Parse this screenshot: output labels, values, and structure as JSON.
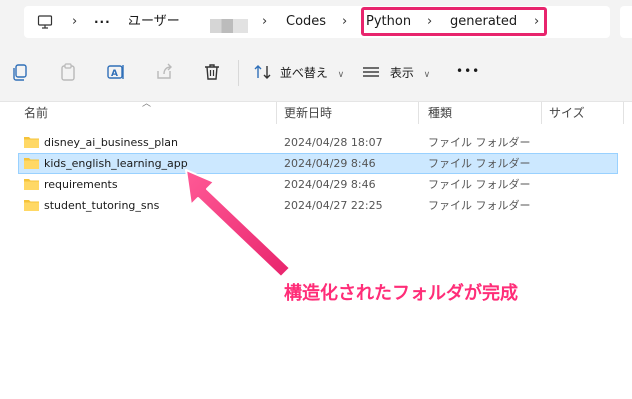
{
  "breadcrumb": {
    "items": [
      "ユーザー",
      "Codes",
      "Python",
      "generated"
    ],
    "overflow": "···"
  },
  "toolbar": {
    "sort_label": "並べ替え",
    "view_label": "表示",
    "more_label": "•••"
  },
  "columns": {
    "name": "名前",
    "modified": "更新日時",
    "type": "種類",
    "size": "サイズ"
  },
  "files": [
    {
      "name": "disney_ai_business_plan",
      "modified": "2024/04/28 18:07",
      "type": "ファイル フォルダー",
      "selected": false
    },
    {
      "name": "kids_english_learning_app",
      "modified": "2024/04/29 8:46",
      "type": "ファイル フォルダー",
      "selected": true
    },
    {
      "name": "requirements",
      "modified": "2024/04/29 8:46",
      "type": "ファイル フォルダー",
      "selected": false
    },
    {
      "name": "student_tutoring_sns",
      "modified": "2024/04/27 22:25",
      "type": "ファイル フォルダー",
      "selected": false
    }
  ],
  "annotation": {
    "text": "構造化されたフォルダが完成"
  },
  "colors": {
    "highlight": "#e8246d",
    "annotation": "#ff2d78",
    "selection": "#cce8ff",
    "folder": "#f5c33b"
  },
  "icons": [
    "computer-icon",
    "copy-icon",
    "paste-icon",
    "rename-icon",
    "share-icon",
    "delete-icon",
    "sort-icon",
    "view-icon",
    "folder-icon"
  ]
}
